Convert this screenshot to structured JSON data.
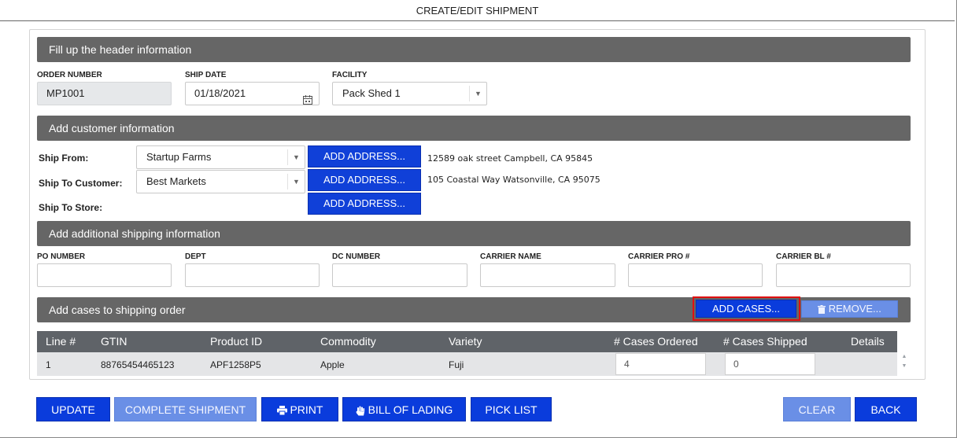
{
  "window": {
    "title": "CREATE/EDIT SHIPMENT"
  },
  "header_section": {
    "title": "Fill up the header information",
    "order_number_label": "ORDER NUMBER",
    "order_number_value": "MP1001",
    "ship_date_label": "SHIP DATE",
    "ship_date_value": "01/18/2021",
    "facility_label": "FACILITY",
    "facility_value": "Pack Shed 1"
  },
  "customer_section": {
    "title": "Add customer information",
    "ship_from_label": "Ship From:",
    "ship_from_value": "Startup Farms",
    "ship_from_button": "ADD ADDRESS...",
    "ship_from_address": "12589 oak street Campbell, CA 95845",
    "ship_to_customer_label": "Ship To Customer:",
    "ship_to_customer_value": "Best Markets",
    "ship_to_customer_button": "ADD ADDRESS...",
    "ship_to_customer_address": "105 Coastal Way Watsonville, CA 95075",
    "ship_to_store_label": "Ship To Store:",
    "ship_to_store_button": "ADD ADDRESS..."
  },
  "shipping_section": {
    "title": "Add additional shipping information",
    "po_number_label": "PO NUMBER",
    "dept_label": "DEPT",
    "dc_number_label": "DC NUMBER",
    "carrier_name_label": "CARRIER NAME",
    "carrier_pro_label": "CARRIER PRO #",
    "carrier_bl_label": "CARRIER BL #"
  },
  "cases_section": {
    "title": "Add cases to shipping order",
    "add_cases_button": "ADD CASES...",
    "remove_button": "REMOVE...",
    "highlight_color": "#e01010",
    "columns": [
      "Line #",
      "GTIN",
      "Product ID",
      "Commodity",
      "Variety",
      "# Cases Ordered",
      "# Cases Shipped",
      "Details"
    ],
    "rows": [
      {
        "line": "1",
        "gtin": "88765454465123",
        "product_id": "APF1258P5",
        "commodity": "Apple",
        "variety": "Fuji",
        "cases_ordered": "4",
        "cases_shipped": "0",
        "details": ""
      }
    ]
  },
  "footer": {
    "update_button": "UPDATE",
    "complete_shipment_button": "COMPLETE SHIPMENT",
    "print_button": "PRINT",
    "bill_of_lading_button": "BILL OF LADING",
    "pick_list_button": "PICK LIST",
    "clear_button": "CLEAR",
    "back_button": "BACK"
  },
  "icons": {
    "calendar": "calendar-icon",
    "select_caret": "chevron-down-icon",
    "trash": "trash-icon",
    "printer": "printer-icon",
    "hand": "hand-icon"
  },
  "colors": {
    "primary_button": "#0a3cdc",
    "disabled_button": "#6a8fe6",
    "section_bar": "#666666",
    "grid_header": "#5f6368"
  }
}
